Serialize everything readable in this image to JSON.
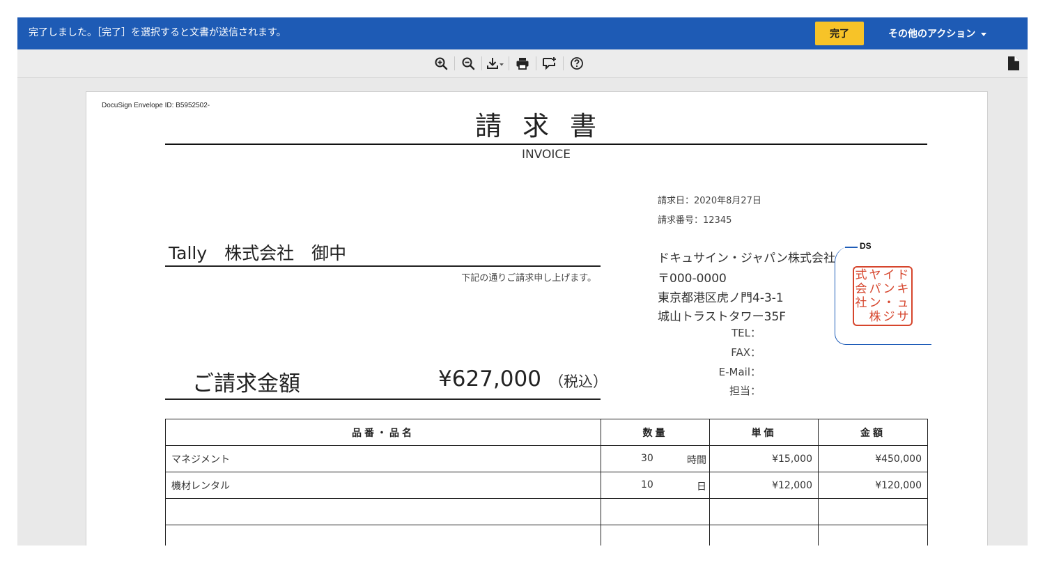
{
  "notification": {
    "message": "完了しました。［完了］を選択すると文書が送信されます。",
    "finish_label": "完了",
    "other_actions_label": "その他のアクション"
  },
  "toolbar": {
    "tools": [
      {
        "name": "zoom-in-icon"
      },
      {
        "name": "zoom-out-icon"
      },
      {
        "name": "download-icon"
      },
      {
        "name": "print-icon"
      },
      {
        "name": "comment-icon"
      },
      {
        "name": "help-icon"
      }
    ],
    "side_icon": "document-icon"
  },
  "colors": {
    "topbar": "#1e5bb5",
    "finish_button": "#f7c328",
    "stamp": "#d6452c",
    "ds_frame": "#1f5db8"
  },
  "document": {
    "envelope_id": "DocuSign Envelope ID: B5952502-",
    "title": "請求書",
    "subtitle": "INVOICE",
    "invoice_date": "請求日：2020年8月27日",
    "invoice_number": "請求番号：12345",
    "addressee": "Tally　株式会社　御中",
    "note": "下記の通りご請求申し上げます。",
    "sender": {
      "company": "ドキュサイン・ジャパン株式会社",
      "postal": "〒000-0000",
      "address1": "東京都港区虎ノ門4-3-1",
      "address2": "城山トラストタワー35F",
      "tel": "TEL：",
      "fax": "FAX：",
      "email": "E-Mail：",
      "person": "担当："
    },
    "ds_label": "DS",
    "stamp_columns": [
      "ドキュ",
      "イン・",
      "ヤパン",
      "式会社"
    ],
    "stamp_columns_extra": [
      "サ",
      "ジ",
      "株"
    ],
    "amount_label": "ご請求金額",
    "amount_value": "¥627,000",
    "amount_tax": "（税込）",
    "table": {
      "headers": [
        "品番・品名",
        "数量",
        "単価",
        "金額"
      ],
      "rows": [
        {
          "name": "マネジメント",
          "qty": "30",
          "unit": "時間",
          "price": "¥15,000",
          "amount": "¥450,000"
        },
        {
          "name": "機材レンタル",
          "qty": "10",
          "unit": "日",
          "price": "¥12,000",
          "amount": "¥120,000"
        },
        {
          "name": "",
          "qty": "",
          "unit": "",
          "price": "",
          "amount": ""
        },
        {
          "name": "",
          "qty": "",
          "unit": "",
          "price": "",
          "amount": ""
        }
      ]
    }
  }
}
